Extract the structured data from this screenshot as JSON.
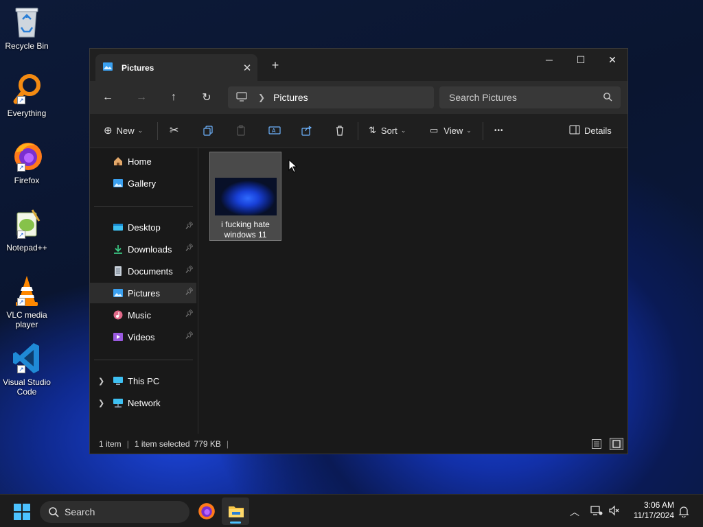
{
  "desktop": {
    "icons": [
      {
        "label": "Recycle Bin",
        "icon": "recycle-bin-icon"
      },
      {
        "label": "Everything",
        "icon": "everything-search-icon"
      },
      {
        "label": "Firefox",
        "icon": "firefox-icon"
      },
      {
        "label": "Notepad++",
        "icon": "notepad-plus-plus-icon"
      },
      {
        "label": "VLC media player",
        "icon": "vlc-icon"
      },
      {
        "label": "Visual Studio Code",
        "icon": "vscode-icon"
      }
    ]
  },
  "window": {
    "tab": {
      "title": "Pictures",
      "icon": "pictures-folder-icon"
    },
    "controls": {
      "minimize": "─",
      "maximize": "☐",
      "close": "✕"
    },
    "address": {
      "crumbs": [
        "Pictures"
      ]
    },
    "search": {
      "placeholder": "Search Pictures"
    },
    "toolbar": {
      "new_label": "New",
      "sort_label": "Sort",
      "view_label": "View",
      "more_label": "•••",
      "details_label": "Details"
    },
    "sidebar": {
      "quick": [
        {
          "label": "Home",
          "icon": "home-icon"
        },
        {
          "label": "Gallery",
          "icon": "gallery-icon"
        }
      ],
      "pinned": [
        {
          "label": "Desktop",
          "icon": "desktop-folder-icon"
        },
        {
          "label": "Downloads",
          "icon": "downloads-icon"
        },
        {
          "label": "Documents",
          "icon": "documents-icon"
        },
        {
          "label": "Pictures",
          "icon": "pictures-folder-icon",
          "selected": true
        },
        {
          "label": "Music",
          "icon": "music-icon"
        },
        {
          "label": "Videos",
          "icon": "videos-icon"
        }
      ],
      "locations": [
        {
          "label": "This PC",
          "icon": "this-pc-icon"
        },
        {
          "label": "Network",
          "icon": "network-icon"
        }
      ]
    },
    "files": [
      {
        "name": "i fucking hate windows 11",
        "selected": true
      }
    ],
    "status": {
      "count": "1 item",
      "selected": "1 item selected",
      "size": "779 KB"
    }
  },
  "taskbar": {
    "search_label": "Search",
    "time": "3:06 AM",
    "date": "11/17/2024"
  },
  "colors": {
    "accent": "#4cc2ff",
    "window_bg": "#191919",
    "taskbar_bg": "#1c1c1c"
  }
}
